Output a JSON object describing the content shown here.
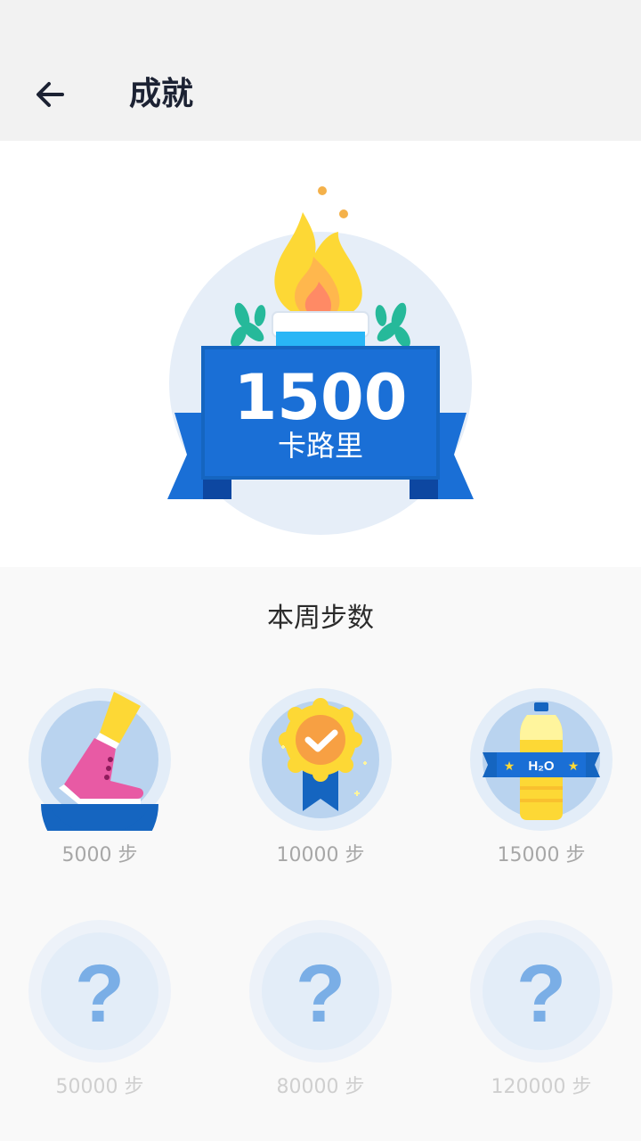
{
  "header": {
    "back_icon": "back-arrow-icon",
    "title": "成就"
  },
  "hero": {
    "value": "1500",
    "unit": "卡路里",
    "icon": "torch-flame-icon"
  },
  "weekly": {
    "title": "本周步数",
    "badges": [
      {
        "label": "5000 步",
        "icon": "sneaker-icon",
        "unlocked": true
      },
      {
        "label": "10000 步",
        "icon": "medal-icon",
        "unlocked": true
      },
      {
        "label": "15000 步",
        "icon": "water-bottle-icon",
        "unlocked": true,
        "icon_text": "H₂O"
      },
      {
        "label": "50000 步",
        "icon": "question-mark-icon",
        "unlocked": false
      },
      {
        "label": "80000 步",
        "icon": "question-mark-icon",
        "unlocked": false
      },
      {
        "label": "120000 步",
        "icon": "question-mark-icon",
        "unlocked": false
      }
    ]
  },
  "colors": {
    "primary_blue": "#1565c0",
    "ribbon_blue": "#1a6fd6",
    "flame_yellow": "#fdd835",
    "circle_bg": "#e3edf8"
  }
}
